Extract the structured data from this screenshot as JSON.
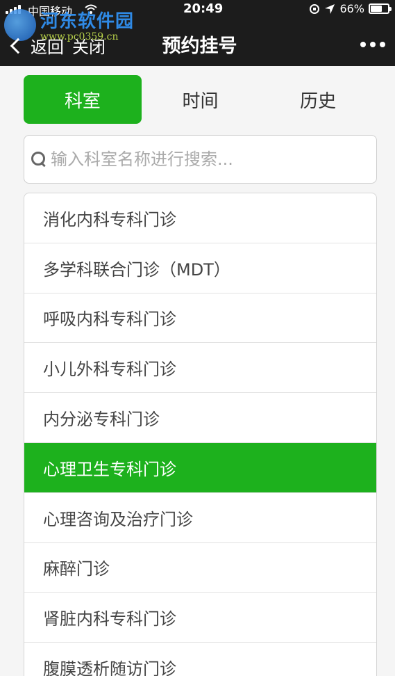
{
  "status_bar": {
    "carrier": "中国移动",
    "time": "20:49",
    "battery": "66%",
    "battery_level": 0.66
  },
  "watermark": {
    "title": "河东软件园",
    "url": "www.pc0359.cn"
  },
  "nav": {
    "back_label": "返回",
    "close_label": "关闭",
    "title": "预约挂号"
  },
  "tabs": [
    {
      "label": "科室",
      "active": true
    },
    {
      "label": "时间",
      "active": false
    },
    {
      "label": "历史",
      "active": false
    }
  ],
  "search": {
    "placeholder": "输入科室名称进行搜索...",
    "value": ""
  },
  "departments": [
    {
      "label": "消化内科专科门诊",
      "selected": false
    },
    {
      "label": "多学科联合门诊（MDT）",
      "selected": false
    },
    {
      "label": "呼吸内科专科门诊",
      "selected": false
    },
    {
      "label": "小儿外科专科门诊",
      "selected": false
    },
    {
      "label": "内分泌专科门诊",
      "selected": false
    },
    {
      "label": "心理卫生专科门诊",
      "selected": true
    },
    {
      "label": "心理咨询及治疗门诊",
      "selected": false
    },
    {
      "label": "麻醉门诊",
      "selected": false
    },
    {
      "label": "肾脏内科专科门诊",
      "selected": false
    },
    {
      "label": "腹膜透析随访门诊",
      "selected": false
    }
  ],
  "colors": {
    "accent": "#1db11d",
    "nav_bg": "#1c1c1c"
  }
}
